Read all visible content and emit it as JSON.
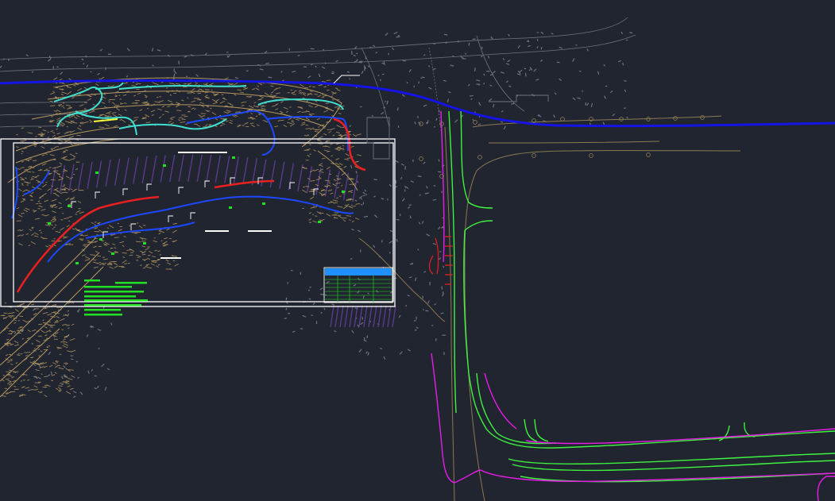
{
  "viewport": {
    "background": "#212530",
    "layers": {
      "terrain": "#b39760",
      "contour_grey": "#6e7380",
      "road_green": "#3ff23f",
      "road_magenta": "#e81ce8",
      "pipe_blue": "#1c48ff",
      "pipe_dark_blue": "#1414e6",
      "pipe_cyan": "#3fe0d0",
      "pipe_red": "#e82020",
      "purple_hatch": "#5a3a8a",
      "road_tan": "#8a7a52",
      "frame_white": "#ffffff",
      "annotation_green": "#22e022",
      "yellow": "#ffff33"
    }
  },
  "drawing_frame": {
    "title_block": {
      "header_color": "#1e90ff",
      "grid_color": "#22e022"
    }
  }
}
